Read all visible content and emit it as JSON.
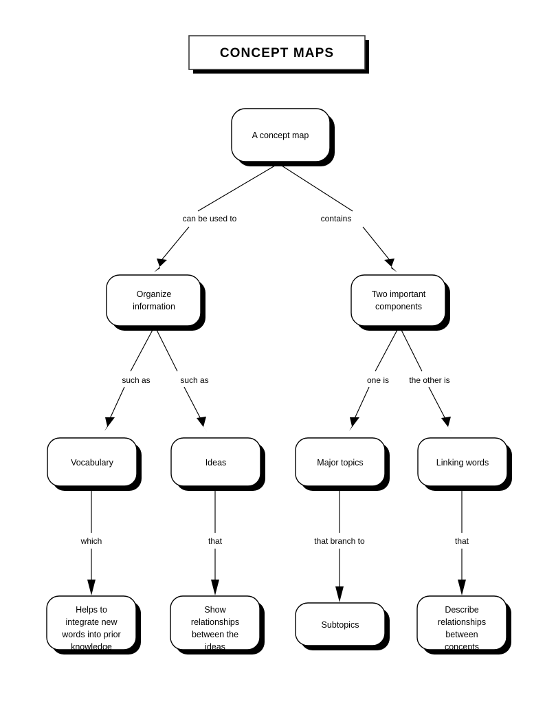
{
  "page": {
    "title": "CONCEPT MAPS",
    "background_color": "#ffffff",
    "ink_color": "#000000"
  },
  "header": {
    "title": "CONCEPT MAPS"
  },
  "diagram": {
    "type": "concept-map",
    "root": "A concept map",
    "nodes": [
      {
        "id": "root",
        "label": "A concept map",
        "lines": [
          "A concept map"
        ]
      },
      {
        "id": "organize",
        "label": "Organize information",
        "lines": [
          "Organize",
          "information"
        ]
      },
      {
        "id": "components",
        "label": "Two important components",
        "lines": [
          "Two important",
          "components"
        ]
      },
      {
        "id": "vocabulary",
        "label": "Vocabulary",
        "lines": [
          "Vocabulary"
        ]
      },
      {
        "id": "ideas",
        "label": "Ideas",
        "lines": [
          "Ideas"
        ]
      },
      {
        "id": "major",
        "label": "Major topics",
        "lines": [
          "Major topics"
        ]
      },
      {
        "id": "linking",
        "label": "Linking words",
        "lines": [
          "Linking words"
        ]
      },
      {
        "id": "helps",
        "label": "Helps to integrate new words into prior knowledge",
        "lines": [
          "Helps to",
          "integrate new",
          "words into prior",
          "knowledge"
        ]
      },
      {
        "id": "show",
        "label": "Show relationships between the ideas",
        "lines": [
          "Show",
          "relationships",
          "between the",
          "ideas"
        ]
      },
      {
        "id": "subtopics",
        "label": "Subtopics",
        "lines": [
          "Subtopics"
        ]
      },
      {
        "id": "describe",
        "label": "Describe relationships between concepts",
        "lines": [
          "Describe",
          "relationships",
          "between",
          "concepts"
        ]
      }
    ],
    "edges": [
      {
        "from": "root",
        "to": "organize",
        "label": "can be used to"
      },
      {
        "from": "root",
        "to": "components",
        "label": "contains"
      },
      {
        "from": "organize",
        "to": "vocabulary",
        "label": "such as"
      },
      {
        "from": "organize",
        "to": "ideas",
        "label": "such as"
      },
      {
        "from": "components",
        "to": "major",
        "label": "one is"
      },
      {
        "from": "components",
        "to": "linking",
        "label": "the other is"
      },
      {
        "from": "vocabulary",
        "to": "helps",
        "label": "which"
      },
      {
        "from": "ideas",
        "to": "show",
        "label": "that"
      },
      {
        "from": "major",
        "to": "subtopics",
        "label": "that branch to"
      },
      {
        "from": "linking",
        "to": "describe",
        "label": "that"
      }
    ]
  }
}
